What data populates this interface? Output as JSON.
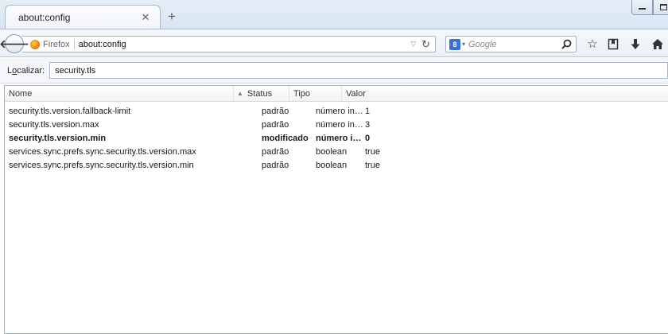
{
  "window": {
    "tab_title": "about:config",
    "tab_close_icon": "close-icon",
    "new_tab_icon": "plus-icon"
  },
  "navbar": {
    "identity_label": "Firefox",
    "url": "about:config",
    "search_engine_badge": "8",
    "search_placeholder": "Google"
  },
  "filter": {
    "label_prefix": "L",
    "label_underlined": "o",
    "label_suffix": "calizar:",
    "value": "security.tls"
  },
  "table": {
    "headers": {
      "name": "Nome",
      "status": "Status",
      "type": "Tipo",
      "value": "Valor"
    },
    "sorted_column": "status",
    "rows": [
      {
        "name": "security.tls.version.fallback-limit",
        "status": "padrão",
        "type": "número int...",
        "value": "1",
        "bold": false
      },
      {
        "name": "security.tls.version.max",
        "status": "padrão",
        "type": "número int...",
        "value": "3",
        "bold": false
      },
      {
        "name": "security.tls.version.min",
        "status": "modificado",
        "type": "número in...",
        "value": "0",
        "bold": true
      },
      {
        "name": "services.sync.prefs.sync.security.tls.version.max",
        "status": "padrão",
        "type": "boolean",
        "value": "true",
        "bold": false
      },
      {
        "name": "services.sync.prefs.sync.security.tls.version.min",
        "status": "padrão",
        "type": "boolean",
        "value": "true",
        "bold": false
      }
    ]
  }
}
